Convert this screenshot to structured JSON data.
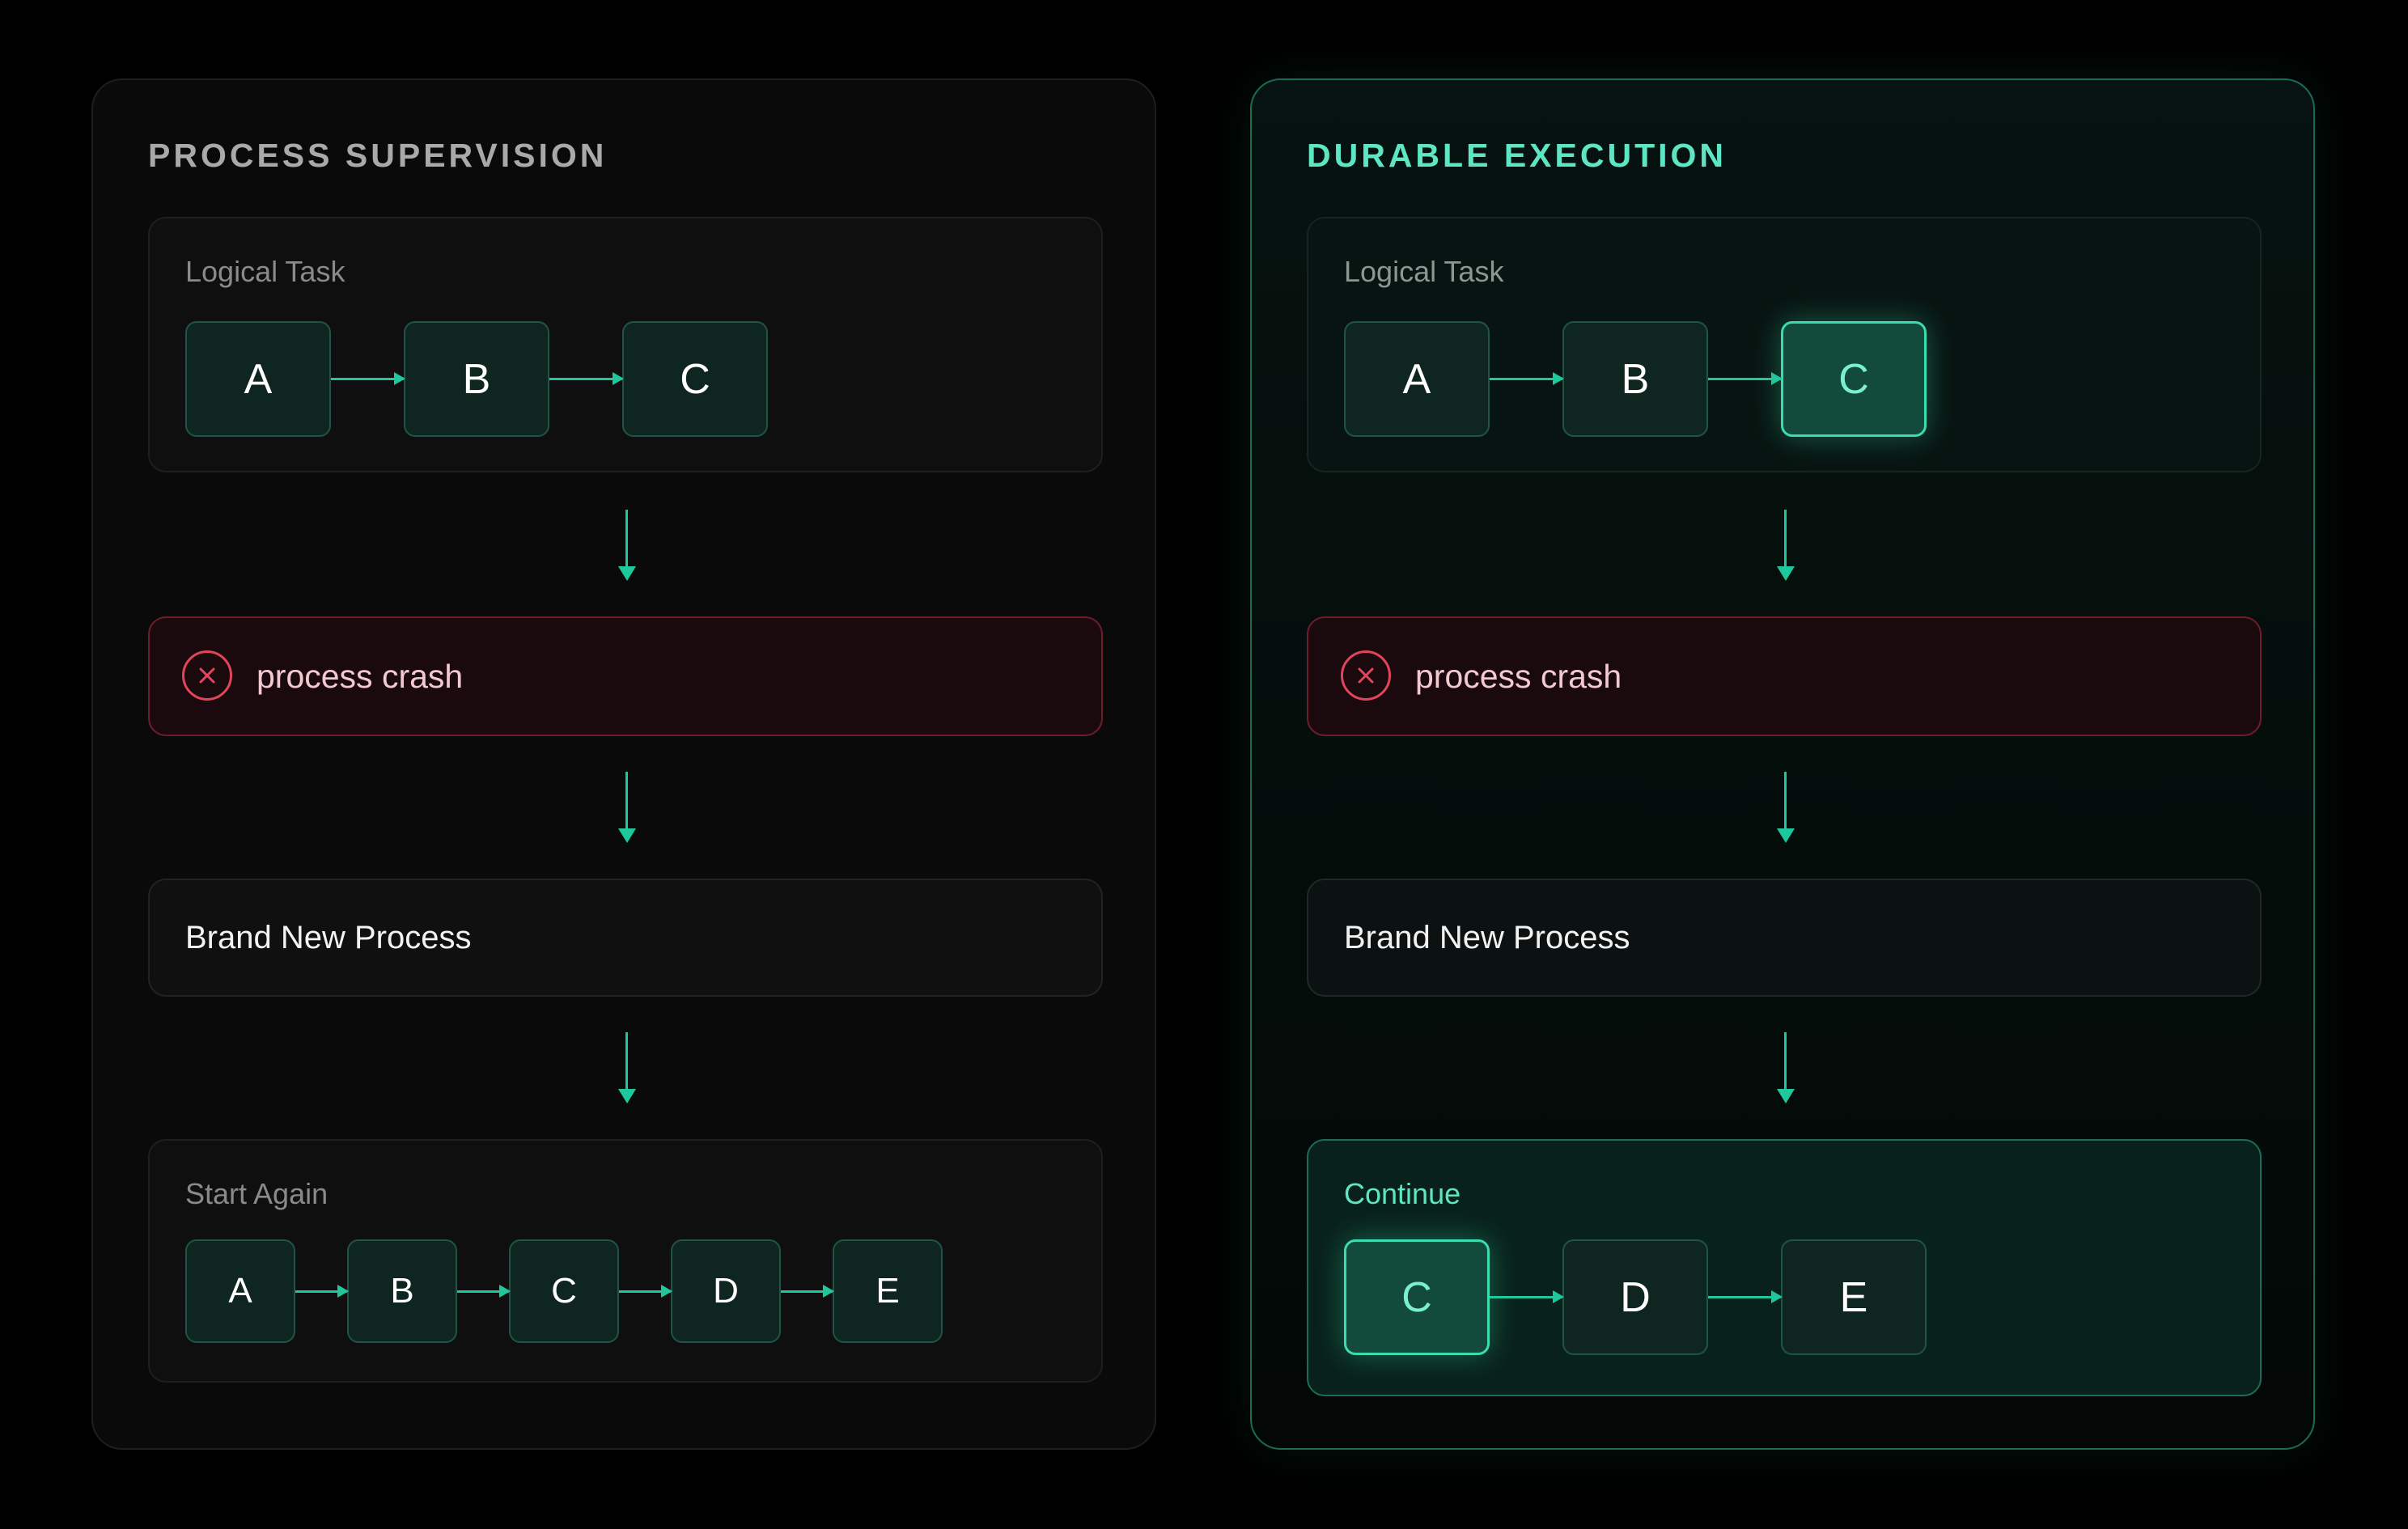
{
  "left_panel": {
    "title": "PROCESS SUPERVISION",
    "task": {
      "label": "Logical Task",
      "nodes": [
        "A",
        "B",
        "C"
      ]
    },
    "crash": {
      "text": "process crash",
      "icon": "x-circle-icon"
    },
    "new_process": {
      "text": "Brand New Process"
    },
    "result": {
      "label": "Start Again",
      "nodes": [
        "A",
        "B",
        "C",
        "D",
        "E"
      ]
    }
  },
  "right_panel": {
    "title": "DURABLE EXECUTION",
    "task": {
      "label": "Logical Task",
      "nodes": [
        "A",
        "B",
        "C"
      ],
      "highlighted": "C"
    },
    "crash": {
      "text": "process crash",
      "icon": "x-circle-icon"
    },
    "new_process": {
      "text": "Brand New Process"
    },
    "result": {
      "label": "Continue",
      "nodes": [
        "C",
        "D",
        "E"
      ],
      "highlighted": "C"
    }
  },
  "colors": {
    "accent": "#1fc79d",
    "accent_light": "#5ee6c4",
    "crash": "#e0455b",
    "background": "#000000"
  }
}
